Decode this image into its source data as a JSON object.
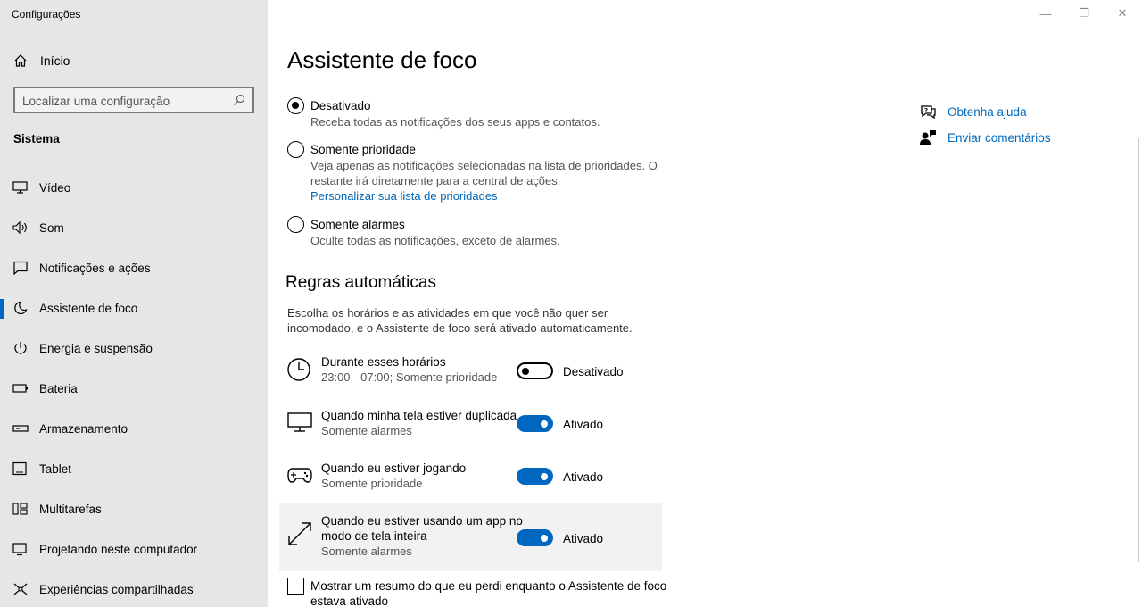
{
  "window": {
    "title": "Configurações",
    "minimize_glyph": "—",
    "restore_glyph": "❐",
    "close_glyph": "✕"
  },
  "sidebar": {
    "home_label": "Início",
    "search_placeholder": "Localizar uma configuração",
    "section_heading": "Sistema",
    "items": [
      {
        "label": "Vídeo",
        "icon": "monitor-icon"
      },
      {
        "label": "Som",
        "icon": "speaker-icon"
      },
      {
        "label": "Notificações e ações",
        "icon": "notification-icon"
      },
      {
        "label": "Assistente de foco",
        "icon": "moon-icon",
        "active": true
      },
      {
        "label": "Energia e suspensão",
        "icon": "power-icon"
      },
      {
        "label": "Bateria",
        "icon": "battery-icon"
      },
      {
        "label": "Armazenamento",
        "icon": "storage-icon"
      },
      {
        "label": "Tablet",
        "icon": "tablet-icon"
      },
      {
        "label": "Multitarefas",
        "icon": "multitask-icon"
      },
      {
        "label": "Projetando neste computador",
        "icon": "projecting-icon"
      },
      {
        "label": "Experiências compartilhadas",
        "icon": "shared-icon"
      }
    ]
  },
  "main": {
    "title": "Assistente de foco",
    "options": [
      {
        "title": "Desativado",
        "desc": "Receba todas as notificações dos seus apps e contatos.",
        "checked": true
      },
      {
        "title": "Somente prioridade",
        "desc": "Veja apenas as notificações selecionadas na lista de prioridades. O restante irá diretamente para a central de ações.",
        "link": "Personalizar sua lista de prioridades",
        "checked": false
      },
      {
        "title": "Somente alarmes",
        "desc": "Oculte todas as notificações, exceto de alarmes.",
        "checked": false
      }
    ],
    "rules_heading": "Regras automáticas",
    "rules_desc": "Escolha os horários e as atividades em que você não quer ser incomodado, e o Assistente de foco será ativado automaticamente.",
    "rules": [
      {
        "title": "Durante esses horários",
        "sub": "23:00 - 07:00; Somente prioridade",
        "state": "Desativado",
        "on": false,
        "icon": "clock-icon"
      },
      {
        "title": "Quando minha tela estiver duplicada",
        "sub": "Somente alarmes",
        "state": "Ativado",
        "on": true,
        "icon": "display-icon"
      },
      {
        "title": "Quando eu estiver jogando",
        "sub": "Somente prioridade",
        "state": "Ativado",
        "on": true,
        "icon": "gamepad-icon"
      },
      {
        "title": "Quando eu estiver usando um app no modo de tela inteira",
        "sub": "Somente alarmes",
        "state": "Ativado",
        "on": true,
        "icon": "fullscreen-icon"
      }
    ],
    "summary_checkbox": "Mostrar um resumo do que eu perdi enquanto o Assistente de foco estava ativado"
  },
  "help": {
    "get_help": "Obtenha ajuda",
    "feedback": "Enviar comentários"
  }
}
